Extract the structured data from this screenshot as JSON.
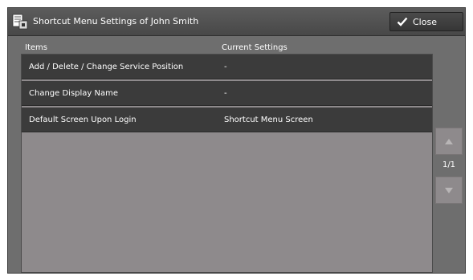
{
  "window": {
    "title": "Shortcut Menu Settings of John Smith",
    "icon": "settings-document-icon",
    "close_label": "Close"
  },
  "columns": {
    "items": "Items",
    "current_settings": "Current Settings"
  },
  "rows": [
    {
      "item": "Add / Delete / Change Service Position",
      "setting": "-"
    },
    {
      "item": "Change Display Name",
      "setting": "-"
    },
    {
      "item": "Default Screen Upon Login",
      "setting": "Shortcut Menu Screen"
    }
  ],
  "pagination": {
    "indicator": "1/1"
  },
  "colors": {
    "frame": "#6e6e6e",
    "titlebar": "#484848",
    "row": "#3b3b3b",
    "list_area": "#8e8a8c"
  }
}
